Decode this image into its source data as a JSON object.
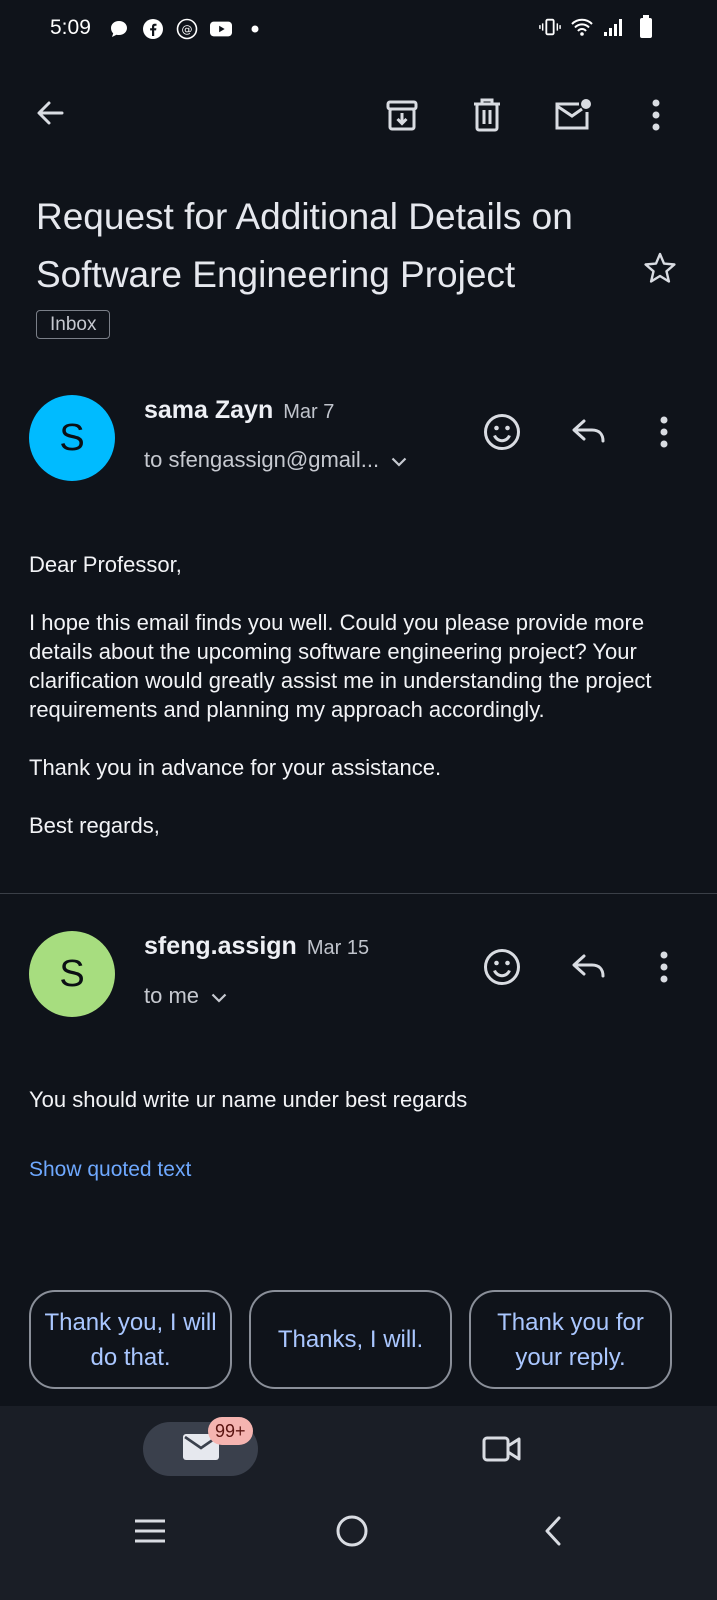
{
  "status_bar": {
    "time": "5:09",
    "left_icons": [
      "chat-bubble-icon",
      "facebook-icon",
      "threads-icon",
      "youtube-icon",
      "dot-icon"
    ],
    "right_icons": [
      "vibrate-icon",
      "wifi-icon",
      "signal-icon",
      "battery-icon"
    ]
  },
  "toolbar": {
    "icons": [
      "back-arrow-icon",
      "archive-icon",
      "delete-icon",
      "mark-unread-icon",
      "more-vert-icon"
    ]
  },
  "subject": {
    "title": "Request for Additional Details on Software Engineering Project",
    "label": "Inbox"
  },
  "messages": [
    {
      "avatar_letter": "S",
      "avatar_color": "#00bbff",
      "sender": "sama Zayn",
      "date": "Mar 7",
      "recipient": "to sfengassign@gmail...",
      "body": [
        "Dear Professor,",
        "I hope this email finds you well. Could you please provide more details about the upcoming software engineering project? Your clarification would greatly assist me in understanding the project requirements and planning my approach accordingly.",
        "Thank you in advance for your assistance.",
        "Best regards,"
      ]
    },
    {
      "avatar_letter": "S",
      "avatar_color": "#a7dd7f",
      "sender": "sfeng.assign",
      "date": "Mar 15",
      "recipient": "to me",
      "body": [
        "You should write ur name under best regards"
      ],
      "quoted_link": "Show quoted text"
    }
  ],
  "smart_replies": [
    "Thank you, I will do that.",
    "Thanks, I will.",
    "Thank you for your reply."
  ],
  "bottom_nav": {
    "mail_badge": "99+",
    "tabs": [
      "mail-icon",
      "video-icon"
    ]
  },
  "system_nav": [
    "recents-icon",
    "home-icon",
    "back-icon"
  ]
}
